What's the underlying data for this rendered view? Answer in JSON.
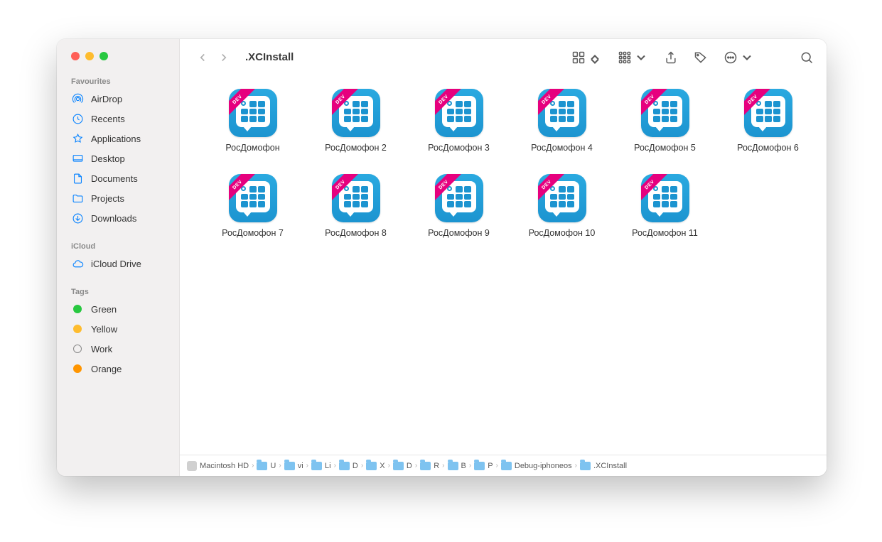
{
  "window": {
    "title": ".XCInstall"
  },
  "sidebar": {
    "favourites_label": "Favourites",
    "icloud_label": "iCloud",
    "tags_label": "Tags",
    "favourites": [
      {
        "label": "AirDrop",
        "icon": "airdrop"
      },
      {
        "label": "Recents",
        "icon": "clock"
      },
      {
        "label": "Applications",
        "icon": "apps"
      },
      {
        "label": "Desktop",
        "icon": "desktop"
      },
      {
        "label": "Documents",
        "icon": "document"
      },
      {
        "label": "Projects",
        "icon": "folder"
      },
      {
        "label": "Downloads",
        "icon": "download"
      }
    ],
    "icloud": [
      {
        "label": "iCloud Drive",
        "icon": "cloud"
      }
    ],
    "tags": [
      {
        "label": "Green",
        "color": "#28c840"
      },
      {
        "label": "Yellow",
        "color": "#febc2e"
      },
      {
        "label": "Work",
        "color": "hollow"
      },
      {
        "label": "Orange",
        "color": "#ff9500"
      }
    ]
  },
  "files": [
    {
      "label": "РосДомофон"
    },
    {
      "label": "РосДомофон 2"
    },
    {
      "label": "РосДомофон 3"
    },
    {
      "label": "РосДомофон 4"
    },
    {
      "label": "РосДомофон 5"
    },
    {
      "label": "РосДомофон 6"
    },
    {
      "label": "РосДомофон 7"
    },
    {
      "label": "РосДомофон 8"
    },
    {
      "label": "РосДомофон 9"
    },
    {
      "label": "РосДомофон 10"
    },
    {
      "label": "РосДомофон 11"
    }
  ],
  "ribbon": "DEV",
  "pathbar": [
    {
      "label": "Macintosh HD",
      "type": "disk"
    },
    {
      "label": "U",
      "type": "folder"
    },
    {
      "label": "vi",
      "type": "folder"
    },
    {
      "label": "Li",
      "type": "folder"
    },
    {
      "label": "D",
      "type": "folder"
    },
    {
      "label": "X",
      "type": "folder"
    },
    {
      "label": "D",
      "type": "folder"
    },
    {
      "label": "R",
      "type": "folder"
    },
    {
      "label": "B",
      "type": "folder"
    },
    {
      "label": "P",
      "type": "folder"
    },
    {
      "label": "Debug-iphoneos",
      "type": "folder"
    },
    {
      "label": ".XCInstall",
      "type": "folder"
    }
  ]
}
